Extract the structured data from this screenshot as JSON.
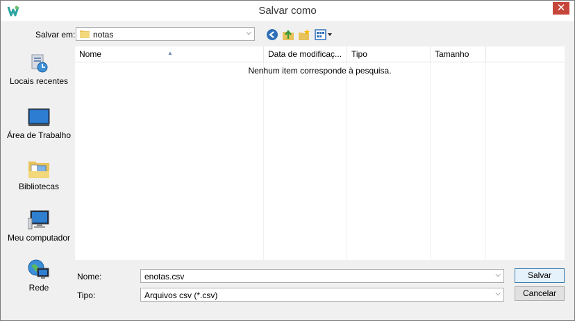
{
  "window": {
    "title": "Salvar como",
    "close_glyph": "✕"
  },
  "toolbar": {
    "save_in_label": "Salvar em:",
    "save_in_value": "notas",
    "icons": [
      "back-icon",
      "up-folder-icon",
      "new-folder-icon",
      "view-menu-icon"
    ]
  },
  "places": [
    {
      "label": "Locais recentes",
      "icon": "recent-places-icon"
    },
    {
      "label": "Área de Trabalho",
      "icon": "desktop-icon"
    },
    {
      "label": "Bibliotecas",
      "icon": "libraries-icon"
    },
    {
      "label": "Meu computador",
      "icon": "computer-icon"
    },
    {
      "label": "Rede",
      "icon": "network-icon"
    }
  ],
  "filelist": {
    "columns": [
      "Nome",
      "Data de modificaç...",
      "Tipo",
      "Tamanho"
    ],
    "empty_message": "Nenhum item corresponde à pesquisa."
  },
  "form": {
    "name_label": "Nome:",
    "name_value": "enotas.csv",
    "type_label": "Tipo:",
    "type_value": "Arquivos csv (*.csv)"
  },
  "buttons": {
    "save": "Salvar",
    "cancel": "Cancelar"
  },
  "colors": {
    "close": "#c7463b",
    "folder": "#e8c25a",
    "accent": "#3c7fb1"
  }
}
